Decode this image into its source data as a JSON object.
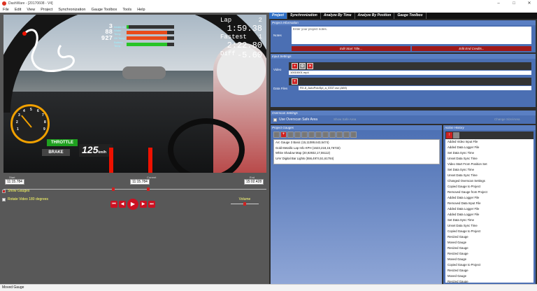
{
  "window": {
    "title": "DashWare - [20170608 - V4]"
  },
  "menu": [
    "File",
    "Edit",
    "View",
    "Project",
    "Synchronization",
    "Gauge Toolbox",
    "Tools",
    "Help"
  ],
  "overlay": {
    "telemetry": [
      {
        "value": "3",
        "label": "Intake Air",
        "fill": 0.05,
        "color": "#27c427"
      },
      {
        "value": "88",
        "label": "Water Temp",
        "fill": 0.85,
        "color": "#e94b1a"
      },
      {
        "value": "927",
        "label": "Oil Temp",
        "fill": 0.85,
        "color": "#e94b1a"
      },
      {
        "value": "",
        "label": "Battery Temp",
        "fill": 0.85,
        "color": "#27c427"
      }
    ],
    "lap_label": "Lap",
    "lap_num": "2",
    "lap_time": "1:59.38",
    "fastest_label": "Fastest",
    "fastest_num": "1",
    "fastest_time": "2:22.80",
    "diff_label": "Diff",
    "diff_value": "-5.60",
    "gauge_ticks": [
      "1",
      "2",
      "3",
      "4",
      "5",
      "6",
      "7",
      "8",
      "9"
    ],
    "throttle": "THROTTLE",
    "brake": "BRAKE",
    "speed": "125",
    "speed_unit": "km/h"
  },
  "timeline": {
    "start_label": "Start",
    "start_value": "11:15.784",
    "current_label": "Current",
    "current_value": "11:15.784",
    "end_label": "End",
    "end_value": "15:02.428"
  },
  "volume_label": "Volume",
  "checkboxes": {
    "show_gauges": "Show Gauges",
    "rotate_video": "Rotate Video 180 degrees"
  },
  "tabs": [
    "Project",
    "Synchronization",
    "Analyze By Time",
    "Analyze By Position",
    "Gauge Toolbox"
  ],
  "project_info": {
    "header": "Project Information",
    "notes_label": "Notes",
    "notes_placeholder": "Enter your project notes.",
    "edit_start": "Edit Start Title...",
    "edit_end": "Edit End Credits..."
  },
  "input_settings": {
    "header": "Input Settings",
    "video_label": "Video",
    "video_file": "10010001.mp4",
    "data_label": "Data Files",
    "data_file": "RX-8_AutoPoloSpl_a_0337.csv (AIM)"
  },
  "overscan": {
    "header": "Overscan Settings",
    "checkbox": "Use Overscan Safe Area",
    "show_label": "Show Safe Area",
    "button": "Change Size/Area"
  },
  "project_gauges": {
    "header": "Project Gauges",
    "items": [
      "Arc Gauge 3 Basic (15,11089,643,5474)",
      "Gold Metallic Lap Info KPH (1623,218,15,76732)",
      "White Shadow Map (20,92932,17,55112)",
      "UAV Digital Bar Lights (556,4974,51,61784)"
    ]
  },
  "action_history": {
    "header": "Action History",
    "items": [
      "Added Video Input File",
      "Added Data Logger File",
      "Set Data Sync Time",
      "Unset Data Sync Time",
      "Video Start From Position Set",
      "Set Data Sync Time",
      "Unset Data Sync Time",
      "Changed Overscan Settings",
      "Copied Gauge to Project",
      "Removed Gauge from Project",
      "Added Data Logger File",
      "Removed Data Input File",
      "Added Data Logger File",
      "Added Data Logger File",
      "Set Data Sync Time",
      "Unset Data Sync Time",
      "Copied Gauge to Project",
      "Resized Gauge",
      "Moved Gauge",
      "Resized Gauge",
      "Resized Gauge",
      "Moved Gauge",
      "Copied Gauge to Project",
      "Resized Gauge",
      "Moved Gauge",
      "Resized Gauge",
      "Moved Gauge",
      "Copied Gauge to Project"
    ]
  },
  "status": "Moved Gauge"
}
